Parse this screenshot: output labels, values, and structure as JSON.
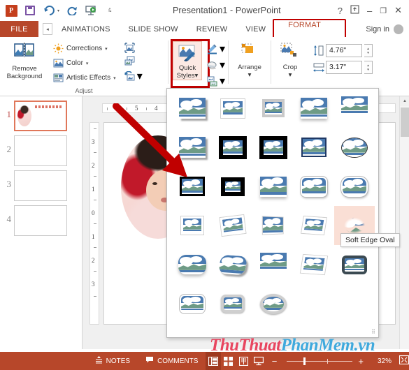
{
  "titlebar": {
    "app_icon": "powerpoint-logo-icon",
    "document_title": "Presentation1 - PowerPoint",
    "qat": [
      {
        "name": "save-icon",
        "label": "Save"
      },
      {
        "name": "undo-icon",
        "label": "Undo"
      },
      {
        "name": "redo-icon",
        "label": "Redo"
      },
      {
        "name": "start-presentation-icon",
        "label": "Start From Beginning"
      },
      {
        "name": "customize-qat-icon",
        "label": "Customize Quick Access Toolbar"
      }
    ],
    "window_controls": [
      {
        "name": "help-button",
        "glyph": "?"
      },
      {
        "name": "ribbon-display-options-button",
        "glyph": "⤒"
      },
      {
        "name": "minimize-button",
        "glyph": "–"
      },
      {
        "name": "restore-button",
        "glyph": "❐"
      },
      {
        "name": "close-button",
        "glyph": "✕"
      }
    ]
  },
  "tabs": {
    "file_label": "FILE",
    "scroll_left_glyph": "◂",
    "items": [
      {
        "label": "ANIMATIONS",
        "active": false
      },
      {
        "label": "SLIDE SHOW",
        "active": false
      },
      {
        "label": "REVIEW",
        "active": false
      },
      {
        "label": "VIEW",
        "active": false
      },
      {
        "label": "FORMAT",
        "active": true
      }
    ],
    "signin_label": "Sign in",
    "highlight_color": "#c00000"
  },
  "ribbon": {
    "groups": [
      {
        "name": "adjust",
        "label": "Adjust",
        "remove_background_label": "Remove\nBackground",
        "remove_background_line1": "Remove",
        "remove_background_line2": "Background",
        "commands": [
          {
            "label": "Corrections",
            "icon": "corrections-icon",
            "has_caret": true
          },
          {
            "label": "Color",
            "icon": "color-icon",
            "has_caret": true
          },
          {
            "label": "Artistic Effects",
            "icon": "artistic-effects-icon",
            "has_caret": true
          }
        ],
        "icon_commands": [
          {
            "name": "compress-pictures-icon"
          },
          {
            "name": "change-picture-icon"
          },
          {
            "name": "reset-picture-icon",
            "has_caret": true
          }
        ]
      },
      {
        "name": "picture-styles",
        "quick_styles_line1": "Quick",
        "quick_styles_line2": "Styles",
        "side_commands": [
          {
            "name": "picture-border-icon",
            "has_caret": true
          },
          {
            "name": "picture-effects-icon",
            "has_caret": true
          },
          {
            "name": "picture-layout-icon",
            "has_caret": true
          }
        ]
      },
      {
        "name": "arrange",
        "arrange_label": "Arrange",
        "caret": "▾"
      },
      {
        "name": "size",
        "crop_label": "Crop",
        "crop_caret": "▾",
        "height_value": "4.76\"",
        "width_value": "3.17\"",
        "height_icon": "shape-height-icon",
        "width_icon": "shape-width-icon"
      }
    ]
  },
  "quick_styles_gallery": {
    "tooltip": "Soft Edge Oval",
    "hovered_index": 19,
    "rows": [
      [
        {
          "index": 0,
          "name": "simple-frame-white",
          "style": "s-shadow-dr"
        },
        {
          "index": 1,
          "name": "beveled-matte-white",
          "style": "s-white"
        },
        {
          "index": 2,
          "name": "metal-frame",
          "style": "s-gray"
        },
        {
          "index": 3,
          "name": "drop-shadow-rectangle",
          "style": "s-shadow-soft"
        },
        {
          "index": 4,
          "name": "reflected-rounded-rectangle",
          "style": "s-refl"
        }
      ],
      [
        {
          "index": 5,
          "name": "soft-edge-rectangle",
          "style": "s-shadow-dr"
        },
        {
          "index": 6,
          "name": "double-frame-black",
          "style": "s-blackdouble"
        },
        {
          "index": 7,
          "name": "thick-matte-black",
          "style": "s-blackthick"
        },
        {
          "index": 8,
          "name": "simple-frame-black",
          "style": "s-navy"
        },
        {
          "index": 9,
          "name": "bevel-rectangle-oval",
          "style": "s-oval"
        }
      ],
      [
        {
          "index": 10,
          "name": "center-shadow-rectangle",
          "style": "s-black"
        },
        {
          "index": 11,
          "name": "rounded-diagonal-corner-white",
          "style": "s-blackthick"
        },
        {
          "index": 12,
          "name": "snip-diagonal-corner-white",
          "style": "s-shadow-soft"
        },
        {
          "index": 13,
          "name": "moderate-frame-white",
          "style": "s-round"
        },
        {
          "index": 14,
          "name": "rotated-white",
          "style": "s-round-lg"
        }
      ],
      [
        {
          "index": 15,
          "name": "perspective-shadow-white",
          "style": "s-white"
        },
        {
          "index": 16,
          "name": "relaxed-perspective-white",
          "style": "s-tilt"
        },
        {
          "index": 17,
          "name": "moderate-frame-black",
          "style": "s-persp"
        },
        {
          "index": 18,
          "name": "rotated-gradient",
          "style": "s-tilt2"
        },
        {
          "index": 19,
          "name": "soft-edge-oval",
          "style": "s-soft-edge"
        }
      ],
      [
        {
          "index": 20,
          "name": "bevel-perspective",
          "style": "s-round-lg"
        },
        {
          "index": 21,
          "name": "bevel-perspective-left",
          "style": "s-tilt2"
        },
        {
          "index": 22,
          "name": "reflected-perspective-right",
          "style": "s-refl"
        },
        {
          "index": 23,
          "name": "compound-frame-black",
          "style": "s-white"
        },
        {
          "index": 24,
          "name": "reflected-bevel-black",
          "style": "s-darkframe"
        }
      ],
      [
        {
          "index": 25,
          "name": "reflected-bevel-white",
          "style": "s-round"
        },
        {
          "index": 26,
          "name": "metal-rounded-rectangle",
          "style": "s-bevel"
        },
        {
          "index": 27,
          "name": "metal-oval",
          "style": "s-bevel-oval"
        }
      ]
    ]
  },
  "thumbnails": {
    "slides": [
      {
        "number": "1",
        "selected": true,
        "has_content": true
      },
      {
        "number": "2",
        "selected": false,
        "has_content": false
      },
      {
        "number": "3",
        "selected": false,
        "has_content": false
      },
      {
        "number": "4",
        "selected": false,
        "has_content": false
      }
    ]
  },
  "editor": {
    "h_ruler_ticks": [
      "6",
      "5",
      "4"
    ],
    "v_ruler_ticks": [
      "3",
      "2",
      "1",
      "0",
      "1",
      "2",
      "3"
    ],
    "image_alt": "baby-photo-oval"
  },
  "statusbar": {
    "notes_label": "NOTES",
    "comments_label": "COMMENTS",
    "views": [
      {
        "name": "normal-view-button",
        "active": true
      },
      {
        "name": "slide-sorter-view-button",
        "active": false
      },
      {
        "name": "reading-view-button",
        "active": false
      },
      {
        "name": "slideshow-view-button",
        "active": false
      }
    ],
    "zoom_out_glyph": "−",
    "zoom_in_glyph": "+",
    "zoom_percent": "32%",
    "fit_button": "fit-slide-to-window-button",
    "bg_color": "#b7472a"
  },
  "watermark": {
    "part1": "ThuThuat",
    "part2": "PhanMem.vn",
    "color1": "#e8455f",
    "color2": "#3fa9dd"
  }
}
